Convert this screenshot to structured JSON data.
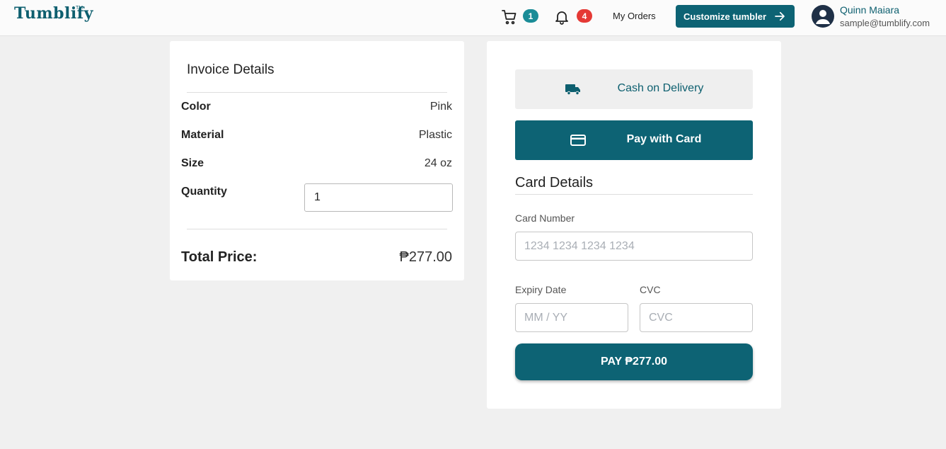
{
  "header": {
    "logo": "Tumblify",
    "logo_tm": "TM",
    "cart_count": "1",
    "notification_count": "4",
    "my_orders": "My Orders",
    "customize_label": "Customize tumbler",
    "user_name": "Quinn Maiara",
    "user_email": "sample@tumblify.com",
    "icons": [
      "cart-icon",
      "bell-icon",
      "arrow-right-icon",
      "user-avatar-icon"
    ]
  },
  "invoice": {
    "title": "Invoice Details",
    "rows": [
      {
        "label": "Color",
        "value": "Pink"
      },
      {
        "label": "Material",
        "value": "Plastic"
      },
      {
        "label": "Size",
        "value": "24 oz"
      }
    ],
    "quantity_label": "Quantity",
    "quantity_value": "1",
    "total_label": "Total Price:",
    "total_value": "₱277.00"
  },
  "payment": {
    "cod_label": "Cash on Delivery",
    "card_label": "Pay with Card",
    "card_details_title": "Card Details",
    "card_number_label": "Card Number",
    "card_number_placeholder": "1234 1234 1234 1234",
    "expiry_label": "Expiry Date",
    "expiry_placeholder": "MM / YY",
    "cvc_label": "CVC",
    "cvc_placeholder": "CVC",
    "pay_button": "PAY ₱277.00"
  },
  "colors": {
    "brand": "#0d6374",
    "badge_teal": "#1a8c97",
    "badge_red": "#e53935",
    "background": "#f0f0f0"
  }
}
